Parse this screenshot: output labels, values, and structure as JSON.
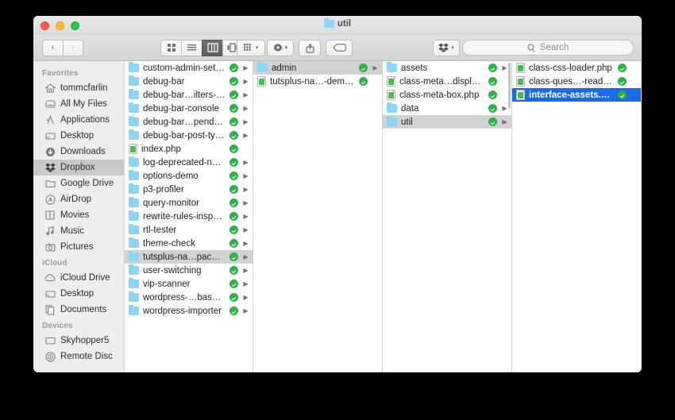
{
  "window": {
    "title": "util",
    "title_icon": "folder-icon",
    "traffic_lights": [
      "close",
      "minimize",
      "maximize"
    ]
  },
  "toolbar": {
    "back_glyph": "‹",
    "forward_glyph": "›",
    "view_modes": [
      {
        "name": "icon-view",
        "active": false
      },
      {
        "name": "list-view",
        "active": false
      },
      {
        "name": "column-view",
        "active": true
      },
      {
        "name": "coverflow-view",
        "active": false
      }
    ],
    "arrange_label": "arrange-icon",
    "action_label": "gear-icon",
    "share_label": "share-icon",
    "tag_label": "tag-icon",
    "dropbox_label": "dropbox-icon",
    "search": {
      "placeholder": "Search",
      "value": "",
      "icon": "search-icon"
    },
    "caret": "▾"
  },
  "sidebar": {
    "sections": [
      {
        "header": "Favorites",
        "items": [
          {
            "label": "tommcfarlin",
            "icon": "home-icon",
            "selected": false
          },
          {
            "label": "All My Files",
            "icon": "all-files-icon",
            "selected": false
          },
          {
            "label": "Applications",
            "icon": "applications-icon",
            "selected": false
          },
          {
            "label": "Desktop",
            "icon": "desktop-icon",
            "selected": false
          },
          {
            "label": "Downloads",
            "icon": "downloads-icon",
            "selected": false
          },
          {
            "label": "Dropbox",
            "icon": "dropbox-icon",
            "selected": true
          },
          {
            "label": "Google Drive",
            "icon": "folder-icon",
            "selected": false
          },
          {
            "label": "AirDrop",
            "icon": "airdrop-icon",
            "selected": false
          },
          {
            "label": "Movies",
            "icon": "movies-icon",
            "selected": false
          },
          {
            "label": "Music",
            "icon": "music-icon",
            "selected": false
          },
          {
            "label": "Pictures",
            "icon": "pictures-icon",
            "selected": false
          }
        ]
      },
      {
        "header": "iCloud",
        "items": [
          {
            "label": "iCloud Drive",
            "icon": "cloud-icon",
            "selected": false
          },
          {
            "label": "Desktop",
            "icon": "desktop-icon",
            "selected": false
          },
          {
            "label": "Documents",
            "icon": "documents-icon",
            "selected": false
          }
        ]
      },
      {
        "header": "Devices",
        "items": [
          {
            "label": "Skyhopper5",
            "icon": "display-icon",
            "selected": false
          },
          {
            "label": "Remote Disc",
            "icon": "remote-disc-icon",
            "selected": false
          }
        ]
      }
    ]
  },
  "columns": [
    {
      "name": "column-1",
      "scrollbar": false,
      "items": [
        {
          "label": "custom-admin-settings",
          "type": "folder",
          "synced": true,
          "disclosure": true,
          "selection": "none"
        },
        {
          "label": "debug-bar",
          "type": "folder",
          "synced": true,
          "disclosure": true,
          "selection": "none"
        },
        {
          "label": "debug-bar…ilters-addon",
          "type": "folder",
          "synced": true,
          "disclosure": true,
          "selection": "none"
        },
        {
          "label": "debug-bar-console",
          "type": "folder",
          "synced": true,
          "disclosure": true,
          "selection": "none"
        },
        {
          "label": "debug-bar…pendencies",
          "type": "folder",
          "synced": true,
          "disclosure": true,
          "selection": "none"
        },
        {
          "label": "debug-bar-post-types",
          "type": "folder",
          "synced": true,
          "disclosure": true,
          "selection": "none"
        },
        {
          "label": "index.php",
          "type": "php",
          "synced": true,
          "disclosure": false,
          "selection": "none"
        },
        {
          "label": "log-deprecated-notices",
          "type": "folder",
          "synced": true,
          "disclosure": true,
          "selection": "none"
        },
        {
          "label": "options-demo",
          "type": "folder",
          "synced": true,
          "disclosure": true,
          "selection": "none"
        },
        {
          "label": "p3-profiler",
          "type": "folder",
          "synced": true,
          "disclosure": true,
          "selection": "none"
        },
        {
          "label": "query-monitor",
          "type": "folder",
          "synced": true,
          "disclosure": true,
          "selection": "none"
        },
        {
          "label": "rewrite-rules-inspector",
          "type": "folder",
          "synced": true,
          "disclosure": true,
          "selection": "none"
        },
        {
          "label": "rtl-tester",
          "type": "folder",
          "synced": true,
          "disclosure": true,
          "selection": "none"
        },
        {
          "label": "theme-check",
          "type": "folder",
          "synced": true,
          "disclosure": true,
          "selection": "none"
        },
        {
          "label": "tutsplus-na…pace-demo",
          "type": "folder",
          "synced": true,
          "disclosure": true,
          "selection": "inactive"
        },
        {
          "label": "user-switching",
          "type": "folder",
          "synced": true,
          "disclosure": true,
          "selection": "none"
        },
        {
          "label": "vip-scanner",
          "type": "folder",
          "synced": true,
          "disclosure": true,
          "selection": "none"
        },
        {
          "label": "wordpress-…base-reset",
          "type": "folder",
          "synced": true,
          "disclosure": true,
          "selection": "none"
        },
        {
          "label": "wordpress-importer",
          "type": "folder",
          "synced": true,
          "disclosure": true,
          "selection": "none"
        }
      ]
    },
    {
      "name": "column-2",
      "scrollbar": false,
      "items": [
        {
          "label": "admin",
          "type": "folder",
          "synced": true,
          "disclosure": true,
          "selection": "inactive"
        },
        {
          "label": "tutsplus-na…-demo.php",
          "type": "php",
          "synced": true,
          "disclosure": false,
          "selection": "none"
        }
      ]
    },
    {
      "name": "column-3",
      "scrollbar": true,
      "items": [
        {
          "label": "assets",
          "type": "folder",
          "synced": true,
          "disclosure": true,
          "selection": "none"
        },
        {
          "label": "class-meta…display.php",
          "type": "php",
          "synced": true,
          "disclosure": false,
          "selection": "none"
        },
        {
          "label": "class-meta-box.php",
          "type": "php",
          "synced": true,
          "disclosure": false,
          "selection": "none"
        },
        {
          "label": "data",
          "type": "folder",
          "synced": true,
          "disclosure": true,
          "selection": "none"
        },
        {
          "label": "util",
          "type": "folder",
          "synced": true,
          "disclosure": true,
          "selection": "inactive"
        }
      ]
    },
    {
      "name": "column-4",
      "scrollbar": false,
      "items": [
        {
          "label": "class-css-loader.php",
          "type": "php",
          "synced": true,
          "disclosure": false,
          "selection": "none"
        },
        {
          "label": "class-ques…-reader.php",
          "type": "php",
          "synced": true,
          "disclosure": false,
          "selection": "none"
        },
        {
          "label": "interface-assets.php",
          "type": "php",
          "synced": true,
          "disclosure": false,
          "selection": "active"
        }
      ]
    }
  ]
}
